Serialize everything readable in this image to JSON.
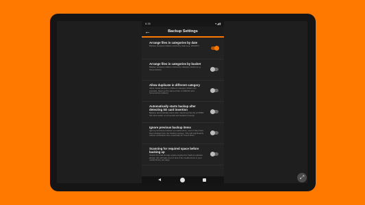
{
  "status_bar": {
    "time": "6:35",
    "icons": "▾◢▮"
  },
  "app_bar": {
    "title": "Backup Settings",
    "back_icon": "arrow-left-icon"
  },
  "colors": {
    "accent": "#ff7900",
    "background": "#222222"
  },
  "settings": [
    {
      "title": "Arrange files in categories by date",
      "description": "Backup analyses folders named by date (e.g. 2022/07)",
      "enabled": true
    },
    {
      "title": "Arrange files in categories by bucket",
      "description": "Backup analyses folders named by category bucket (e.g. Screenshots)",
      "enabled": false
    },
    {
      "title": "Allow duplicate in different category",
      "description": "Allow media backup in different category folders (for example, back up the same photo to 2022/12 and Screenshots folders)",
      "enabled": false
    },
    {
      "title": "Automatically starts backup after detecting SD card insertion",
      "description": "Backup automatically starts after detecting that the pl XPBD SD card reader is connected and loaded correctly",
      "enabled": false
    },
    {
      "title": "Ignore previous backup items",
      "description": "Ignore previously backed up media items, even if they have been deleted from the backup storage. This will significantly reduce verification time especially for Cloud Drive.",
      "enabled": false
    },
    {
      "title": "Scanning for required space before backing up",
      "description": "Check the total storage space required for backup updates ahead, this will take a lot of time if the media items in your media library are large.",
      "enabled": false
    }
  ],
  "nav_bar": {
    "back_icon": "triangle-back-icon",
    "home_icon": "circle-home-icon",
    "recents_icon": "square-recents-icon"
  },
  "expand_icon": "expand-diagonal-icon",
  "expand_glyph": "⤢"
}
